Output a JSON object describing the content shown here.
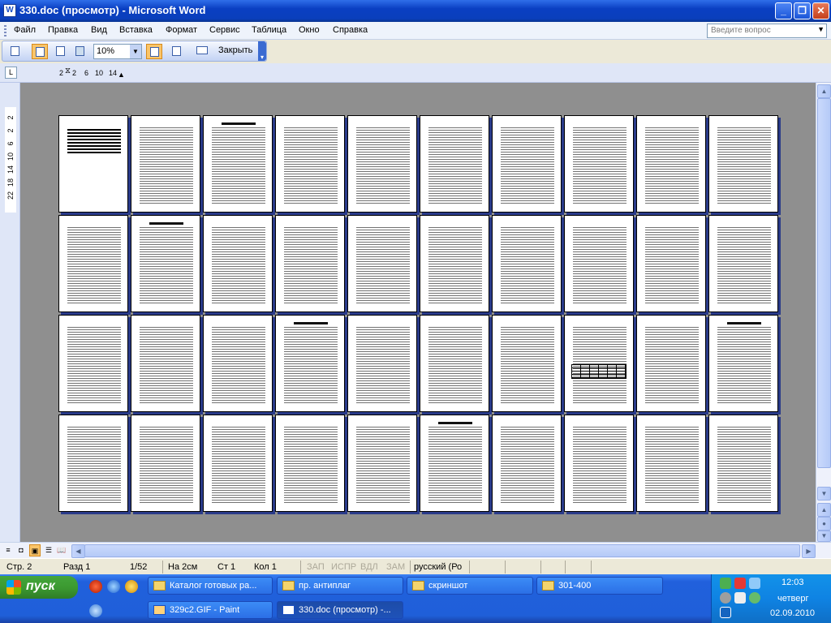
{
  "window": {
    "title": "330.doc (просмотр) - Microsoft Word",
    "app_icon": "W"
  },
  "menu": {
    "items": [
      "Файл",
      "Правка",
      "Вид",
      "Вставка",
      "Формат",
      "Сервис",
      "Таблица",
      "Окно",
      "Справка"
    ],
    "help_placeholder": "Введите вопрос"
  },
  "toolbar": {
    "zoom": "10%",
    "close_label": "Закрыть"
  },
  "ruler": {
    "h_labels": [
      "2",
      "2",
      "6",
      "10",
      "14"
    ],
    "v_labels": [
      "2",
      "2",
      "6",
      "10",
      "14",
      "18",
      "22"
    ]
  },
  "status": {
    "page": "Стр. 2",
    "section": "Разд 1",
    "pages": "1/52",
    "at": "На 2см",
    "line": "Ст 1",
    "col": "Кол 1",
    "rec": "ЗАП",
    "trk": "ИСПР",
    "ext": "ВДЛ",
    "ovr": "ЗАМ",
    "lang": "русский (Ро"
  },
  "taskbar": {
    "start": "пуск",
    "tasks_row1": [
      "Каталог готовых ра...",
      "пр. антиплаг",
      "скриншот",
      "301-400"
    ],
    "tasks_row2": [
      "329c2.GIF - Paint",
      "330.doc (просмотр) -..."
    ],
    "clock_time": "12:03",
    "clock_day": "четверг",
    "clock_date": "02.09.2010"
  }
}
